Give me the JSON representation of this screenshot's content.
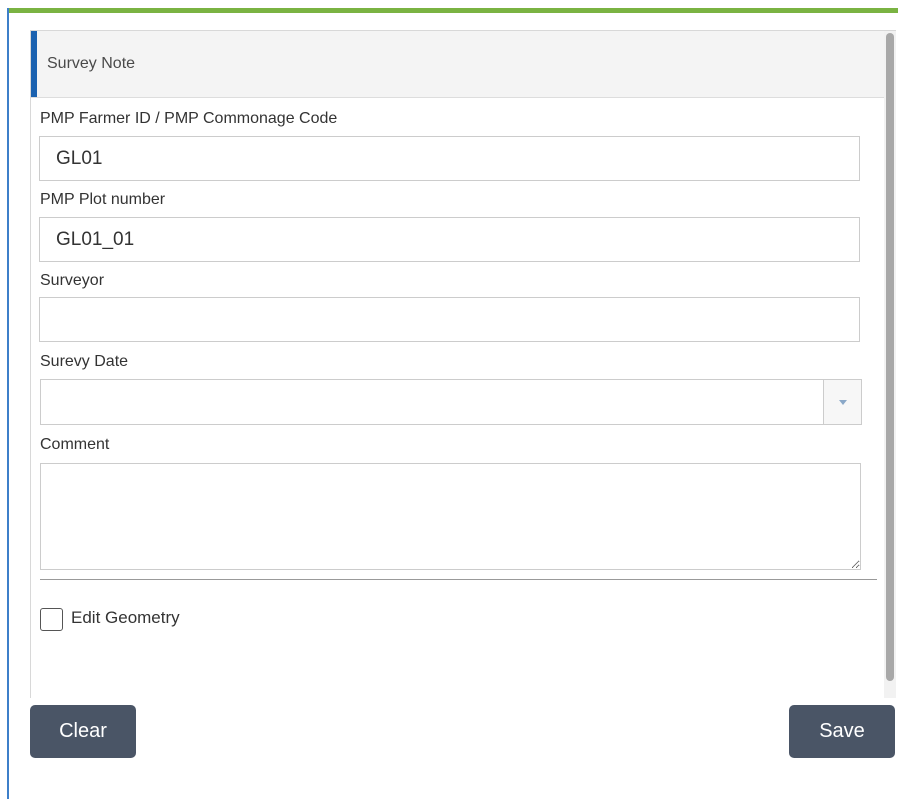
{
  "header": {
    "title": "Survey Note"
  },
  "fields": {
    "farmer_id": {
      "label": "PMP Farmer ID / PMP Commonage Code",
      "value": "GL01"
    },
    "plot_number": {
      "label": "PMP Plot number",
      "value": "GL01_01"
    },
    "surveyor": {
      "label": "Surveyor",
      "value": ""
    },
    "survey_date": {
      "label": "Surevy Date",
      "value": ""
    },
    "comment": {
      "label": "Comment",
      "value": ""
    }
  },
  "edit_geometry": {
    "label": "Edit Geometry",
    "checked": false
  },
  "buttons": {
    "clear": "Clear",
    "save": "Save"
  },
  "colors": {
    "accent_top": "#7ab342",
    "accent_header": "#1b62b0",
    "button_bg": "#4a5566"
  }
}
